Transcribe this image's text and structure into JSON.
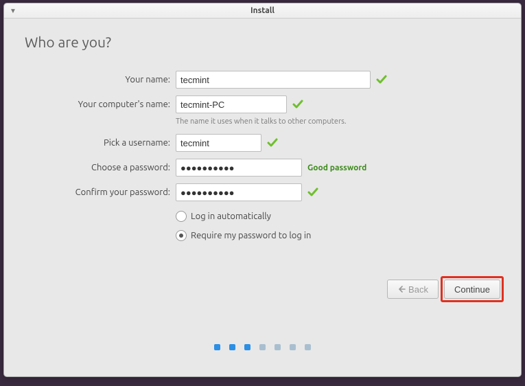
{
  "window": {
    "title": "Install"
  },
  "heading": "Who are you?",
  "labels": {
    "name": "Your name:",
    "computer": "Your computer's name:",
    "computer_helper": "The name it uses when it talks to other computers.",
    "username": "Pick a username:",
    "password": "Choose a password:",
    "confirm": "Confirm your password:"
  },
  "values": {
    "name": "tecmint",
    "computer": "tecmint-PC",
    "username": "tecmint",
    "password": "●●●●●●●●●●",
    "confirm": "●●●●●●●●●●"
  },
  "password_strength": "Good password",
  "radios": {
    "auto": "Log in automatically",
    "require": "Require my password to log in"
  },
  "buttons": {
    "back": "Back",
    "continue": "Continue"
  }
}
